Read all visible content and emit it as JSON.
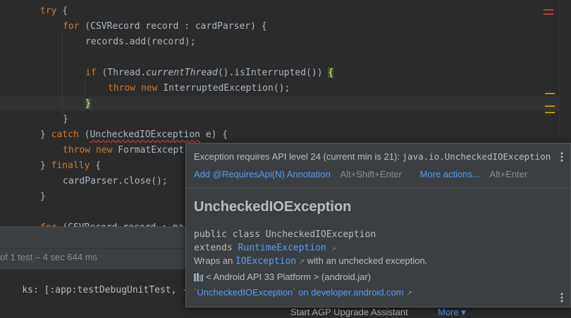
{
  "editor": {
    "lines": [
      {
        "indent": 0,
        "parts": [
          [
            "kw",
            "try"
          ],
          [
            "plain",
            " {"
          ]
        ]
      },
      {
        "indent": 1,
        "parts": [
          [
            "kw",
            "for"
          ],
          [
            "plain",
            " (CSVRecord record : cardParser) {"
          ]
        ]
      },
      {
        "indent": 2,
        "parts": [
          [
            "plain",
            "records.add(record);"
          ]
        ]
      },
      {
        "indent": 0,
        "parts": []
      },
      {
        "indent": 2,
        "parts": [
          [
            "kw",
            "if"
          ],
          [
            "plain",
            " (Thread."
          ],
          [
            "it",
            "currentThread"
          ],
          [
            "plain",
            "().isInterrupted()) "
          ],
          [
            "brace",
            "{"
          ]
        ]
      },
      {
        "indent": 3,
        "parts": [
          [
            "kw",
            "throw new"
          ],
          [
            "plain",
            " InterruptedException();"
          ]
        ]
      },
      {
        "indent": 2,
        "parts": [
          [
            "brace",
            "}"
          ]
        ]
      },
      {
        "indent": 1,
        "parts": [
          [
            "plain",
            "}"
          ]
        ]
      },
      {
        "indent": 0,
        "parts": [
          [
            "plain",
            "} "
          ],
          [
            "kw",
            "catch"
          ],
          [
            "plain",
            " ("
          ],
          [
            "squiggle",
            "UncheckedIOException"
          ],
          [
            "plain",
            " e) {"
          ]
        ]
      },
      {
        "indent": 1,
        "parts": [
          [
            "kw",
            "throw new"
          ],
          [
            "plain",
            " FormatExcept"
          ]
        ]
      },
      {
        "indent": 0,
        "parts": [
          [
            "plain",
            "} "
          ],
          [
            "kw",
            "finally"
          ],
          [
            "plain",
            " {"
          ]
        ]
      },
      {
        "indent": 1,
        "parts": [
          [
            "plain",
            "cardParser.close();"
          ]
        ]
      },
      {
        "indent": 0,
        "parts": [
          [
            "plain",
            "}"
          ]
        ]
      },
      {
        "indent": 0,
        "parts": []
      },
      {
        "indent": 0,
        "parts": [
          [
            "kw",
            "for"
          ],
          [
            "plain",
            " (CSVRecord record : pa"
          ]
        ]
      }
    ]
  },
  "bottom_panel": {
    "status": "of 1 test – 4 sec 644 ms",
    "console_line": "ks: [:app:testDebugUnitTest, --te",
    "agp_label": "Start AGP Upgrade Assistant",
    "more_label": "More ▾"
  },
  "popup": {
    "message_prefix": "Exception requires API level 24 (current min is 21): ",
    "message_class": "java.io.UncheckedIOException",
    "action1_label": "Add @RequiresApi(N) Annotation",
    "action1_shortcut": "Alt+Shift+Enter",
    "action2_label": "More actions...",
    "action2_shortcut": "Alt+Enter",
    "doc_title": "UncheckedIOException",
    "decl_line1": "public class UncheckedIOException",
    "decl_extends": "extends ",
    "decl_super": "RuntimeException",
    "wraps_prefix": "Wraps an ",
    "wraps_link": "IOException",
    "wraps_suffix": " with an unchecked exception.",
    "library": "< Android API 33 Platform > (android.jar)",
    "external_link": "`UncheckedIOException` on developer.android.com",
    "kebab_icon": "more-vertical-icon",
    "external_icon": "external-link-arrow-icon",
    "library_icon": "library-icon"
  },
  "colors": {
    "keyword": "#cc7832",
    "link": "#589df6",
    "error": "#bc3f3c",
    "warning_mark": "#be9117"
  }
}
